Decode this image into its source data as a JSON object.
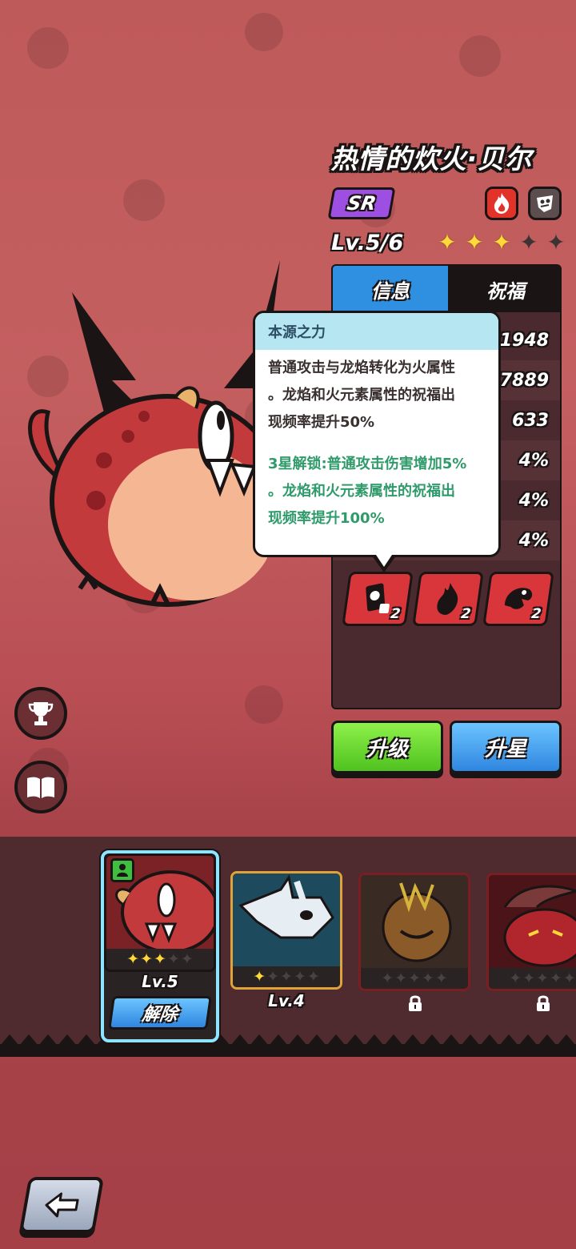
{
  "hero": {
    "name": "热情的炊火·贝尔",
    "rarity": "SR",
    "level_text": "Lv.5/6",
    "stars_filled": 3,
    "stars_total": 5,
    "elements": [
      "fire-element-icon",
      "dark-element-icon"
    ]
  },
  "tabs": {
    "info": "信息",
    "blessing": "祝福"
  },
  "stats": [
    "1948",
    "7889",
    "633",
    "4%",
    "4%",
    "4%"
  ],
  "skills": [
    {
      "icon": "card-skill-icon",
      "count": "2"
    },
    {
      "icon": "flame-skill-icon",
      "count": "2"
    },
    {
      "icon": "dragon-skill-icon",
      "count": "2"
    }
  ],
  "tooltip": {
    "title": "本源之力",
    "line1": "普通攻击与龙焰转化为火属性",
    "line2": "。龙焰和火元素属性的祝福出",
    "line3": "现频率提升50%",
    "line4": "3星解锁:普通攻击伤害增加5%",
    "line5": "。龙焰和火元素属性的祝福出",
    "line6": "现频率提升100%"
  },
  "buttons": {
    "upgrade": "升级",
    "star_up": "升星"
  },
  "side_buttons": [
    "trophy-icon",
    "book-icon"
  ],
  "roster": [
    {
      "name": "red-dragon",
      "level": "Lv.5",
      "stars_filled": 3,
      "selected": true,
      "action": "解除"
    },
    {
      "name": "bone-dragon",
      "level": "Lv.4",
      "stars_filled": 1,
      "selected": false
    },
    {
      "name": "pumpkin-beast",
      "locked": true,
      "stars_filled": 0
    },
    {
      "name": "horned-demon",
      "locked": true,
      "stars_filled": 0
    }
  ],
  "colors": {
    "accent_blue": "#2f86e0",
    "accent_green": "#4fc21f",
    "rarity_purple": "#9c4fe0",
    "tooltip_green": "#2f9a6a"
  }
}
